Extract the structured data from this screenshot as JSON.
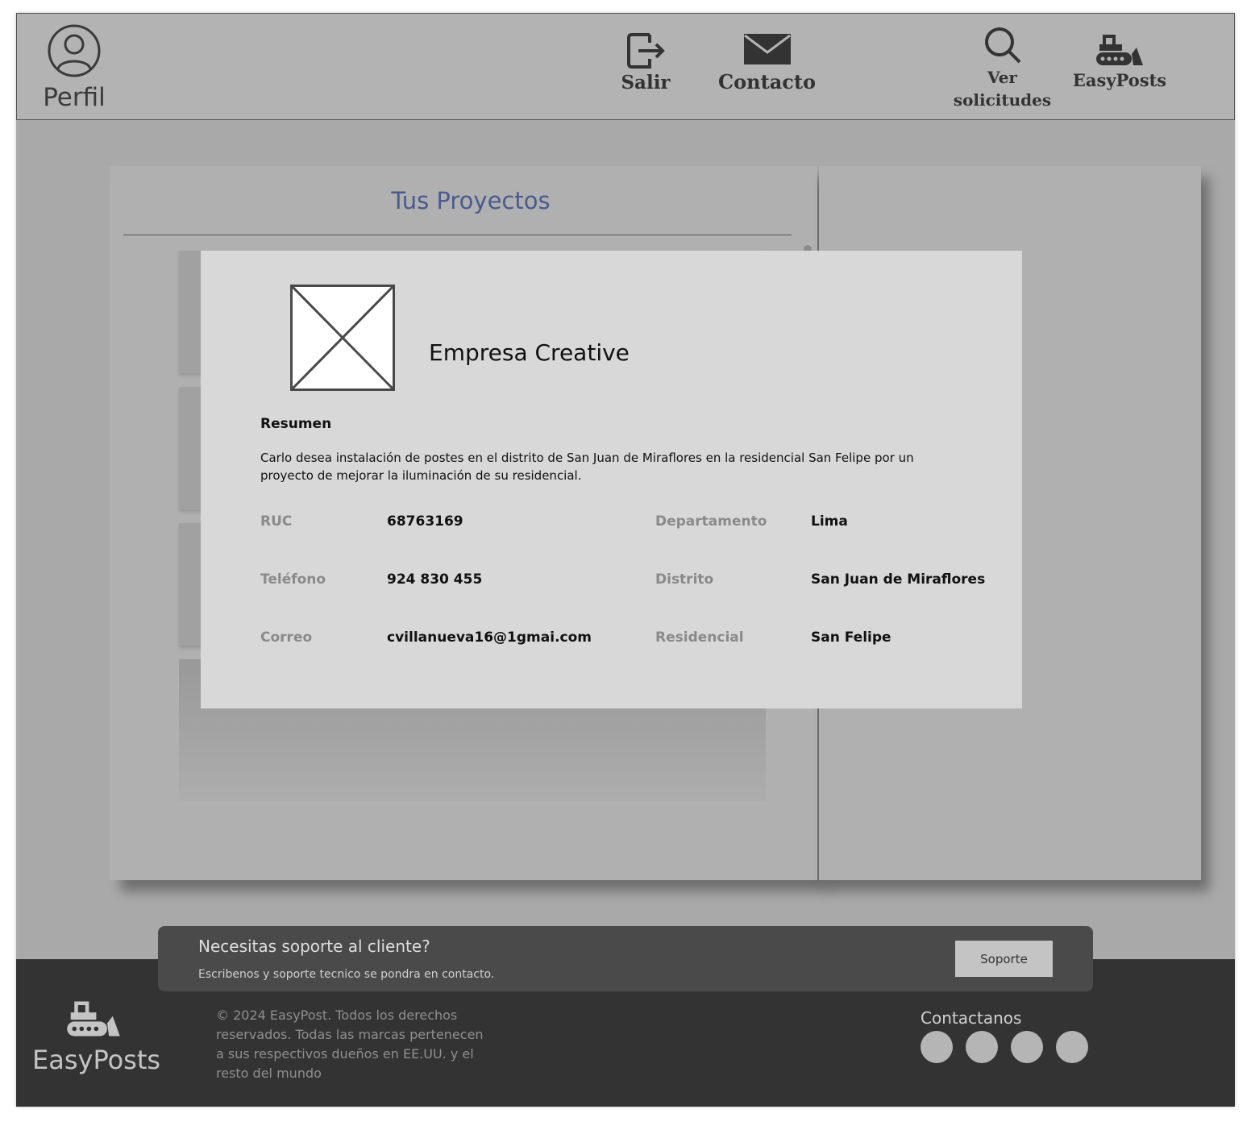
{
  "header": {
    "perfil_label": "Perfil",
    "salir_label": "Salir",
    "contacto_label": "Contacto",
    "ver_solicitudes_line1": "Ver",
    "ver_solicitudes_line2": "solicitudes",
    "easyposts_label": "EasyPosts"
  },
  "projects": {
    "title": "Tus Proyectos"
  },
  "modal": {
    "company_name": "Empresa Creative",
    "summary_title": "Resumen",
    "summary_text": "Carlo desea instalación de postes en el distrito de San Juan de Miraflores en la residencial San Felipe por un proyecto de mejorar la iluminación de su residencial.",
    "fields": {
      "ruc_label": "RUC",
      "ruc_value": "68763169",
      "telefono_label": "Teléfono",
      "telefono_value": "924 830 455",
      "correo_label": "Correo",
      "correo_value": "cvillanueva16@1gmai.com",
      "departamento_label": "Departamento",
      "departamento_value": "Lima",
      "distrito_label": "Distrito",
      "distrito_value": "San Juan de Miraflores",
      "residencial_label": "Residencial",
      "residencial_value": "San Felipe"
    }
  },
  "support": {
    "title": "Necesitas soporte al cliente?",
    "subtitle": "Escribenos y soporte tecnico se pondra en contacto.",
    "button_label": "Soporte"
  },
  "footer": {
    "brand": "EasyPosts",
    "copyright": "© 2024 EasyPost. Todos los derechos reservados. Todas las marcas pertenecen a sus respectivos dueños en EE.UU. y el resto del mundo",
    "contact_title": "Contactanos"
  },
  "colors": {
    "header_bg": "#b3b3b3",
    "page_bg": "#a9a9a9",
    "modal_bg": "#d8d8d8",
    "title_accent": "#4b5a8f",
    "footer_bg": "#333333"
  },
  "icons": [
    "user-circle-icon",
    "logout-icon",
    "envelope-icon",
    "search-icon",
    "bulldozer-icon"
  ]
}
